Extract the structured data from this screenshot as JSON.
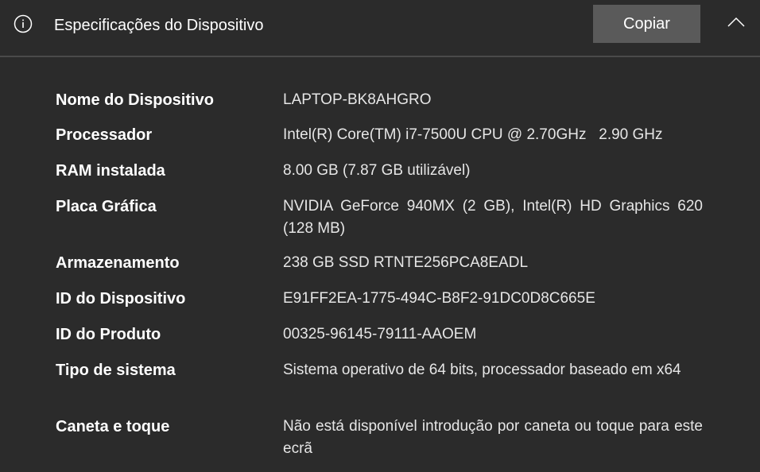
{
  "header": {
    "title": "Especificações do Dispositivo",
    "copy_label": "Copiar",
    "icons": {
      "info": "info-circle-icon",
      "collapse": "chevron-up-icon"
    }
  },
  "specs": [
    {
      "label": "Nome do Dispositivo",
      "value": "LAPTOP-BK8AHGRO"
    },
    {
      "label": "Processador",
      "value": "Intel(R) Core(TM) i7-7500U CPU @ 2.70GHz   2.90 GHz"
    },
    {
      "label": "RAM instalada",
      "value": "8.00 GB (7.87 GB utilizável)"
    },
    {
      "label": "Placa Gráfica",
      "value": "NVIDIA GeForce 940MX (2 GB), Intel(R) HD Graphics 620 (128 MB)"
    },
    {
      "label": "Armazenamento",
      "value": "238 GB SSD RTNTE256PCA8EADL"
    },
    {
      "label": "ID do Dispositivo",
      "value": "E91FF2EA-1775-494C-B8F2-91DC0D8C665E"
    },
    {
      "label": "ID do Produto",
      "value": "00325-96145-79111-AAOEM"
    },
    {
      "label": "Tipo de sistema",
      "value": "Sistema operativo de 64 bits, processador baseado em x64"
    },
    {
      "label": "Caneta e toque",
      "value": "Não está disponível introdução por caneta ou toque para este ecrã"
    }
  ]
}
